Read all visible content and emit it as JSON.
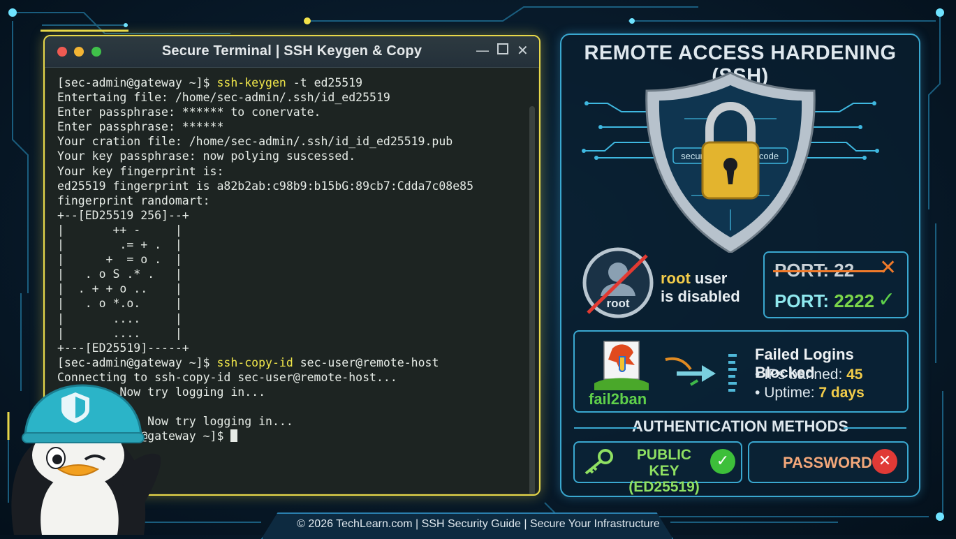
{
  "terminal": {
    "title": "Secure Terminal | SSH Keygen & Copy",
    "lines": [
      {
        "prompt": "[sec-admin@gateway ~]$ ",
        "cmd": "ssh-keygen",
        "rest": " -t ed25519"
      },
      {
        "text": "Entertaing file: /home/sec-admin/.ssh/id_ed25519"
      },
      {
        "text": "Enter passphrase: ****** to conervate."
      },
      {
        "text": "Enter passphrase: ******"
      },
      {
        "text": "Your cration file: /home/sec-admin/.ssh/id_id_ed25519.pub"
      },
      {
        "text": "Your key passphrase: now polying suscessed."
      },
      {
        "text": "Your key fingerprint is:"
      },
      {
        "text": "ed25519 fingerprint is a82b2ab:c98b9:b15bG:89cb7:Cdda7c08e85"
      },
      {
        "text": "fingerprint randomart:"
      },
      {
        "text": "+--[ED25519 256]--+"
      },
      {
        "text": "|       ++ -     |"
      },
      {
        "text": "|        .= + .  |"
      },
      {
        "text": "|      +  = o .  |"
      },
      {
        "text": "|   . o S .* .   |"
      },
      {
        "text": "|  . + + o ..    |"
      },
      {
        "text": "|   . o *.o.     |"
      },
      {
        "text": "|       ....     |"
      },
      {
        "text": "|       ....     |"
      },
      {
        "text": "+---[ED25519]-----+"
      },
      {
        "prompt": "[sec-admin@gateway ~]$ ",
        "cmd": "ssh-copy-id",
        "rest": " sec-user@remote-host"
      },
      {
        "text": "Connecting to ssh-copy-id sec-user@remote-host..."
      },
      {
        "text": "         Now try logging in..."
      },
      {
        "text": ""
      },
      {
        "text": "             Now try logging in..."
      },
      {
        "text": "           n@gateway ~]$ ",
        "cursor": true
      }
    ]
  },
  "panel": {
    "title": "REMOTE ACCESS HARDENING (SSH)",
    "shield_left_text": "secur",
    "shield_right_text": "code",
    "root": {
      "badge": "root",
      "line1_hl": "root",
      "line1_rest": " user",
      "line2": "is disabled"
    },
    "port": {
      "old_label": "PORT: ",
      "old_value": "22",
      "new_label": "PORT: ",
      "new_value": "2222"
    },
    "fail2ban": {
      "logo_text": "fail2ban",
      "heading": "Failed Logins Blocked",
      "items": [
        {
          "label": "IPs banned: ",
          "value": "45"
        },
        {
          "label": "Uptime: ",
          "value": "7 days"
        }
      ]
    },
    "auth": {
      "heading": "AUTHENTICATION METHODS",
      "public_key_line1": "PUBLIC KEY",
      "public_key_line2": "(ED25519)",
      "password": "PASSWORD"
    }
  },
  "footer": "© 2026 TechLearn.com | SSH Security Guide | Secure Your Infrastructure",
  "colors": {
    "terminal_border": "#e8d84a",
    "panel_border": "#3aa8d0",
    "command": "#f0e64a",
    "ok": "#3dbf3a",
    "bad": "#e03a36",
    "warning": "#ef7a2a"
  }
}
